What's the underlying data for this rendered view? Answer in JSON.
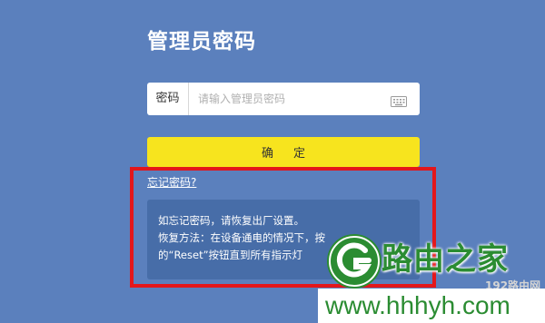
{
  "page": {
    "title": "管理员密码"
  },
  "password": {
    "label": "密码",
    "placeholder": "请输入管理员密码",
    "keyboard_icon": "keyboard-icon"
  },
  "confirm_button": {
    "label": "确定"
  },
  "forgot": {
    "link": "忘记密码?",
    "help_line1": "如忘记密码，请恢复出厂设置。",
    "help_line2": "恢复方法：在设备通电的情况下，按",
    "help_line3": "的“Reset”按钮直到所有指示灯"
  },
  "watermark": {
    "site_name": "路由之家",
    "url": "www.hhhyh.com",
    "small": "192路由网"
  },
  "colors": {
    "background": "#5b80bd",
    "button": "#f7e41e",
    "panel": "#476da8",
    "highlight": "#e3171b",
    "brand_green": "#2b8c32"
  }
}
